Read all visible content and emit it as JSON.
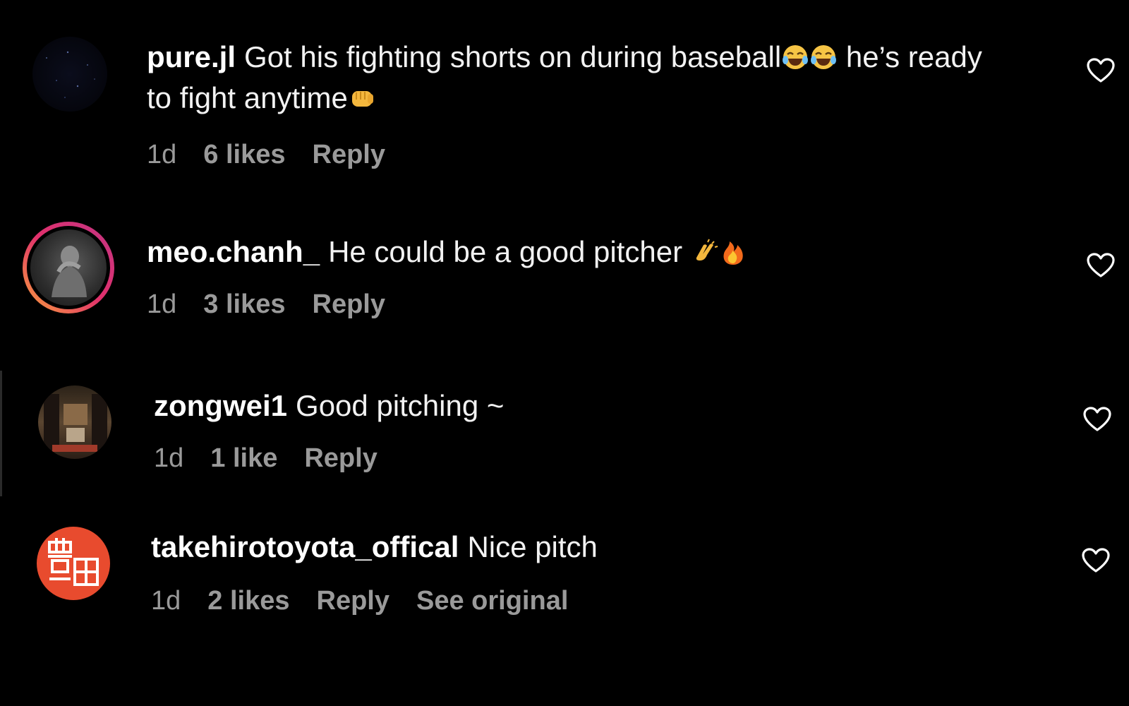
{
  "comments": [
    {
      "username": "pure.jl",
      "text_part1": "Got his fighting shorts on during baseball",
      "text_part2": " he’s ready to fight anytime",
      "time": "1d",
      "likes": "6 likes",
      "reply": "Reply",
      "emojis": [
        "face-with-tears-of-joy",
        "face-with-tears-of-joy",
        "oncoming-fist"
      ]
    },
    {
      "username": "meo.chanh_",
      "text_part1": "He could be a good pitcher ",
      "time": "1d",
      "likes": "3 likes",
      "reply": "Reply",
      "emojis": [
        "clapping-hands",
        "fire"
      ]
    },
    {
      "username": "zongwei1",
      "text_part1": "Good pitching ~",
      "time": "1d",
      "likes": "1 like",
      "reply": "Reply"
    },
    {
      "username": "takehirotoyota_offical",
      "text_part1": "Nice pitch",
      "time": "1d",
      "likes": "2 likes",
      "reply": "Reply",
      "see_original": "See original",
      "avatar_glyph": "豊田"
    }
  ],
  "colors": {
    "background": "#000000",
    "text": "#f2f2f2",
    "meta": "#9a9a9a",
    "story_ring_start": "#f9a23b",
    "story_ring_end": "#c13584",
    "avatar_red": "#e84b2e"
  },
  "icons": {
    "like": "heart-outline-icon"
  }
}
